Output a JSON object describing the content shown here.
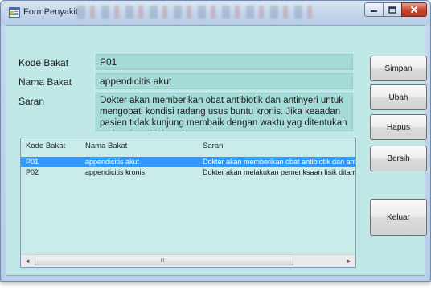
{
  "window": {
    "title": "FormPenyakit"
  },
  "form": {
    "kode_label": "Kode Bakat",
    "kode_value": "P01",
    "nama_label": "Nama Bakat",
    "nama_value": "appendicitis akut",
    "saran_label": "Saran",
    "saran_value": "Dokter akan memberikan obat antibiotik dan antinyeri untuk mengobati kondisi radang usus buntu kronis. Jika keaadan pasien tidak kunjung membaik dengan waktu yag ditentukan maka akan dilakauakan"
  },
  "buttons": {
    "simpan": "Simpan",
    "ubah": "Ubah",
    "hapus": "Hapus",
    "bersih": "Bersih",
    "keluar": "Keluar"
  },
  "list": {
    "columns": [
      "Kode Bakat",
      "Nama Bakat",
      "Saran"
    ],
    "rows": [
      {
        "kode": "P01",
        "nama": "appendicitis akut",
        "saran": "Dokter akan memberikan obat antibiotik dan antin",
        "selected": true
      },
      {
        "kode": "P02",
        "nama": "appendicitis kronis",
        "saran": "Dokter akan melakukan pemeriksaan fisik ditamb",
        "selected": false
      }
    ],
    "scroll_left": "◄",
    "scroll_right": "►",
    "scroll_grip": "III"
  },
  "colors": {
    "client_bg": "#bfe8e6",
    "field_bg": "#a6dcd7",
    "selection": "#3399ff",
    "close_button": "#c5432b"
  }
}
